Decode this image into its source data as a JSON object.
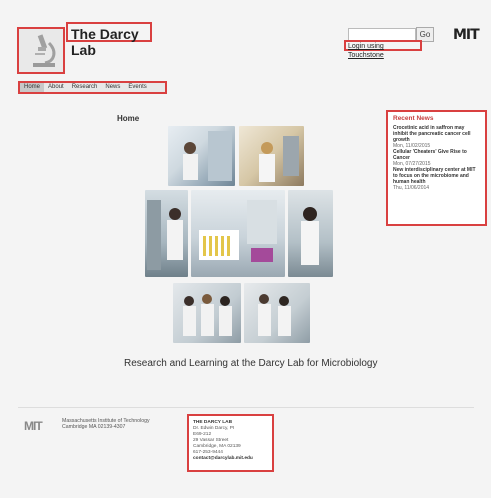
{
  "header": {
    "site_title": "The Darcy Lab",
    "go_label": "Go",
    "mit_logo": "MIT",
    "login_label": "Login using Touchstone"
  },
  "nav": {
    "items": [
      {
        "label": "Home"
      },
      {
        "label": "About"
      },
      {
        "label": "Research"
      },
      {
        "label": "News"
      },
      {
        "label": "Events"
      }
    ]
  },
  "main": {
    "heading": "Home",
    "tagline": "Research and Learning at the Darcy Lab for Microbiology"
  },
  "news": {
    "title": "Recent News",
    "items": [
      {
        "headline": "Crocetinic acid in saffron may inhibit the pancreatic cancer cell growth",
        "date": "Mon, 11/02/2015"
      },
      {
        "headline": "Cellular 'Cheaters' Give Rise to Cancer",
        "date": "Mon, 07/27/2015"
      },
      {
        "headline": "New interdisciplinary center at MIT to focus on the microbiome and human health",
        "date": "Thu, 11/06/2014"
      }
    ]
  },
  "footer": {
    "mit_logo": "MIT",
    "institute": "Massachusetts Institute of Technology",
    "address": "Cambridge MA 02139-4307",
    "contact": {
      "title": "THE DARCY LAB",
      "name": "Dr. Edwin Darcy, PI",
      "room": "E69-212",
      "street": "29 Vassar Street",
      "city": "Cambridge, MA 02139",
      "phone": "617-253-9444",
      "email": "contact@darcylab.mit.edu"
    }
  },
  "colors": {
    "highlight": "#d94040",
    "news_title": "#c64040",
    "page_bg": "#f4f4f4"
  }
}
